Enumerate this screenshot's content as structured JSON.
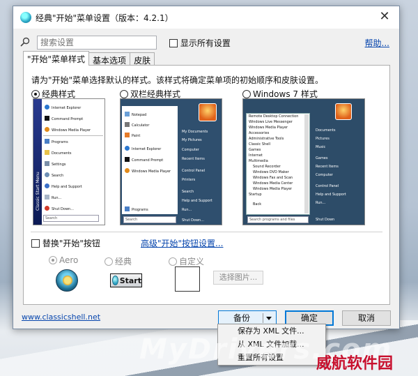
{
  "window": {
    "title": "经典\"开始\"菜单设置（版本：4.2.1）",
    "close": "✕"
  },
  "search": {
    "placeholder": "搜索设置",
    "show_all_label": "显示所有设置",
    "help": "帮助..."
  },
  "tabs": [
    "\"开始\"菜单样式",
    "基本选项",
    "皮肤"
  ],
  "panel": {
    "description": "请为\"开始\"菜单选择默认的样式。该样式将确定菜单项的初始顺序和皮肤设置。",
    "styles": [
      {
        "label": "经典样式",
        "selected": true
      },
      {
        "label": "双栏经典样式",
        "selected": false
      },
      {
        "label": "Windows 7 样式",
        "selected": false
      }
    ],
    "classic_preview": {
      "items": [
        "Internet Explorer",
        "Command Prompt",
        "Windows Media Player",
        "Programs",
        "Documents",
        "Settings",
        "Search",
        "Help and Support",
        "Run...",
        "Shut Down..."
      ],
      "vertical_banner": "Classic Start Menu",
      "search_box": "Search"
    },
    "twocol_preview": {
      "left": [
        "Notepad",
        "Calculator",
        "Paint",
        "Internet Explorer",
        "Command Prompt",
        "Windows Media Player",
        "Programs"
      ],
      "right": [
        "My Documents",
        "My Pictures",
        "Computer",
        "Recent Items",
        "Control Panel",
        "Printers",
        "Search",
        "Help and Support",
        "Run...",
        "Shut Down..."
      ],
      "search_box": "Search"
    },
    "win7_preview": {
      "left": [
        "Remote Desktop Connection",
        "Windows Live Messenger",
        "Windows Media Player",
        "Accessories",
        "Administrative Tools",
        "Classic Shell",
        "Games",
        "Internet",
        "Multimedia",
        "Sound Recorder",
        "Windows DVD Maker",
        "Windows Fax and Scan",
        "Windows Media Center",
        "Windows Media Player",
        "Startup",
        "Back"
      ],
      "right": [
        "Documents",
        "Pictures",
        "Music",
        "Games",
        "Recent Items",
        "Computer",
        "Control Panel",
        "Help and Support",
        "Run...",
        "Shut Down"
      ],
      "search_box": "Search programs and files"
    },
    "replace_label": "替换\"开始\"按钮",
    "advanced_link": "高级\"开始\"按钮设置...",
    "button_options": [
      "Aero",
      "经典",
      "自定义"
    ],
    "start_button_text": "Start",
    "pick_image": "选择图片..."
  },
  "footer": {
    "url": "www.classicshell.net",
    "backup": "备份",
    "ok": "确定",
    "cancel": "取消"
  },
  "backup_menu": [
    "保存为 XML 文件...",
    "从 XML 文件加载...",
    "重置所有设置"
  ],
  "watermark": "MyDrivers.com",
  "brand": "威航软件园"
}
